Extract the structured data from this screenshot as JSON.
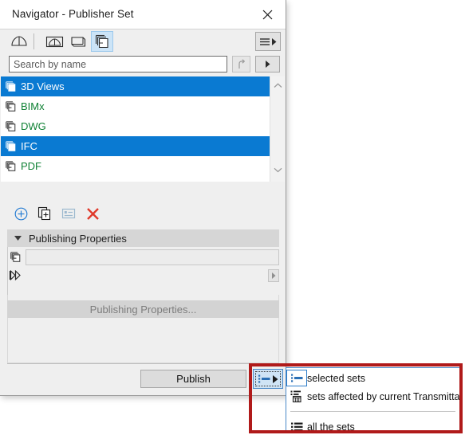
{
  "window": {
    "title": "Navigator - Publisher Set",
    "close_icon": "close-icon"
  },
  "toolbar": {
    "icons": [
      {
        "name": "project-map-icon",
        "label": "Project Map",
        "selected": false
      },
      {
        "name": "view-map-icon",
        "label": "View Map",
        "selected": false
      },
      {
        "name": "layout-book-icon",
        "label": "Layout Book",
        "selected": false
      },
      {
        "name": "publisher-sets-icon",
        "label": "Publisher Sets",
        "selected": true
      }
    ],
    "menu_button": {
      "name": "hamburger-menu-button",
      "icon": "hamburger-icon"
    }
  },
  "search": {
    "placeholder": "Search by name",
    "value": "",
    "up_button_icon": "up-arrow-icon",
    "menu_button_icon": "triangle-right-icon"
  },
  "list": {
    "items": [
      {
        "label": "3D Views",
        "selected": true,
        "icon": "publisher-set-icon"
      },
      {
        "label": "BIMx",
        "selected": false,
        "icon": "publisher-set-icon"
      },
      {
        "label": "DWG",
        "selected": false,
        "icon": "publisher-set-icon"
      },
      {
        "label": "IFC",
        "selected": true,
        "icon": "publisher-set-icon"
      },
      {
        "label": "PDF",
        "selected": false,
        "icon": "publisher-set-icon"
      }
    ],
    "scroll_up_icon": "chevron-up-icon",
    "scroll_down_icon": "chevron-down-icon",
    "colors": {
      "selected_bg": "#0a7ad2",
      "selected_text": "#ffffff",
      "item_text": "#0f8134"
    }
  },
  "actions": [
    {
      "name": "new-set-button",
      "icon": "plus-circle-icon",
      "color": "#2a7fd4"
    },
    {
      "name": "duplicate-set-button",
      "icon": "duplicate-plus-icon",
      "color": "#1b1b1b"
    },
    {
      "name": "set-properties-button",
      "icon": "list-properties-icon",
      "color": "#9db9cf"
    },
    {
      "name": "delete-set-button",
      "icon": "x-delete-icon",
      "color": "#e03a2b"
    }
  ],
  "publishing": {
    "section_title": "Publishing Properties",
    "caret_icon": "caret-down-icon",
    "row_icon": "publisher-set-icon",
    "field_value": "",
    "path_icon": "double-chevron-right-icon",
    "path_menu_icon": "triangle-right-icon",
    "properties_button_label": "Publishing Properties..."
  },
  "footer": {
    "publish_label": "Publish",
    "split_button": {
      "name": "publish-scope-split-button",
      "icon": "selected-sets-icon",
      "arrow_icon": "triangle-right-icon"
    }
  },
  "menu": {
    "items": [
      {
        "label": "selected sets",
        "icon": "selected-sets-icon",
        "active": true
      },
      {
        "label": "sets affected by current Transmittal Set",
        "icon": "transmittal-sets-icon",
        "active": false
      },
      {
        "label": "all the sets",
        "icon": "all-sets-icon",
        "active": false
      }
    ]
  },
  "annotation": {
    "name": "red-highlight-rectangle",
    "color": "#b01a1a"
  }
}
